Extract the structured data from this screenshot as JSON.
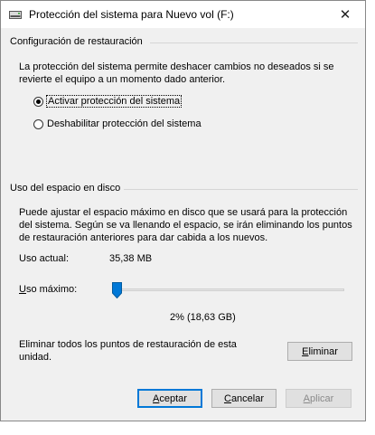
{
  "window": {
    "title": "Protección del sistema para Nuevo vol (F:)",
    "close_glyph": "✕"
  },
  "restore_settings": {
    "group_title": "Configuración de restauración",
    "description": "La protección del sistema permite deshacer cambios no deseados si se revierte el equipo a un momento dado anterior.",
    "options": [
      {
        "label": "Activar protección del sistema",
        "selected": true
      },
      {
        "label": "Deshabilitar protección del sistema",
        "selected": false
      }
    ]
  },
  "disk_usage": {
    "group_title": "Uso del espacio en disco",
    "description": "Puede ajustar el espacio máximo en disco que se usará para la protección del sistema. Según se va llenando el espacio, se irán eliminando los puntos de restauración anteriores para dar cabida a los nuevos.",
    "current_label": "Uso actual:",
    "current_value": "35,38 MB",
    "max_label_first": "U",
    "max_label_rest": "so máximo:",
    "slider_value_percent": 2,
    "slider_readout": "2% (18,63 GB)",
    "delete_text": "Eliminar todos los puntos de restauración de esta unidad.",
    "delete_button_first": "E",
    "delete_button_rest": "liminar"
  },
  "footer": {
    "ok_first": "A",
    "ok_rest": "ceptar",
    "cancel_first": "C",
    "cancel_rest": "ancelar",
    "apply_first": "A",
    "apply_rest": "plicar"
  },
  "colors": {
    "accent": "#0078d7",
    "dialog_bg": "#f0f0f0",
    "disabled_text": "#8a8a8a"
  }
}
